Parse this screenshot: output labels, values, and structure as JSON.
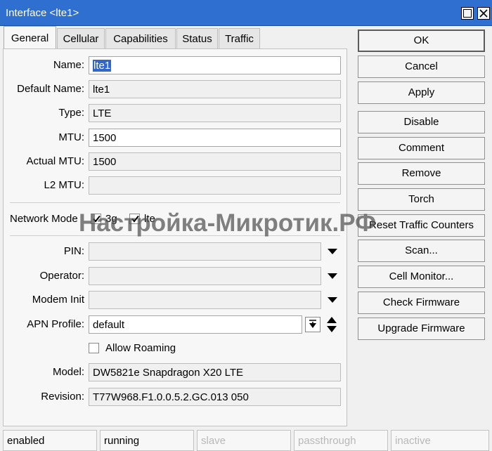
{
  "window": {
    "title": "Interface <lte1>"
  },
  "tabs": [
    {
      "label": "General"
    },
    {
      "label": "Cellular"
    },
    {
      "label": "Capabilities"
    },
    {
      "label": "Status"
    },
    {
      "label": "Traffic"
    }
  ],
  "form": {
    "name": {
      "label": "Name:",
      "value": "lte1"
    },
    "default_name": {
      "label": "Default Name:",
      "value": "lte1"
    },
    "type": {
      "label": "Type:",
      "value": "LTE"
    },
    "mtu": {
      "label": "MTU:",
      "value": "1500"
    },
    "actual_mtu": {
      "label": "Actual MTU:",
      "value": "1500"
    },
    "l2_mtu": {
      "label": "L2 MTU:",
      "value": ""
    },
    "network_mode": {
      "label": "Network Mode",
      "options": [
        {
          "label": "3g",
          "checked": true
        },
        {
          "label": "lte",
          "checked": true
        }
      ]
    },
    "pin": {
      "label": "PIN:",
      "value": ""
    },
    "operator": {
      "label": "Operator:",
      "value": ""
    },
    "modem_init": {
      "label": "Modem Init",
      "value": ""
    },
    "apn_profile": {
      "label": "APN Profile:",
      "value": "default"
    },
    "allow_roaming": {
      "label": "Allow Roaming",
      "checked": false
    },
    "model": {
      "label": "Model:",
      "value": "DW5821e Snapdragon X20 LTE"
    },
    "revision": {
      "label": "Revision:",
      "value": "T77W968.F1.0.0.5.2.GC.013 050"
    }
  },
  "buttons": {
    "ok": "OK",
    "cancel": "Cancel",
    "apply": "Apply",
    "disable": "Disable",
    "comment": "Comment",
    "remove": "Remove",
    "torch": "Torch",
    "reset_counters": "Reset Traffic Counters",
    "scan": "Scan...",
    "cell_monitor": "Cell Monitor...",
    "check_firmware": "Check Firmware",
    "upgrade_firmware": "Upgrade Firmware"
  },
  "statusbar": {
    "enabled": "enabled",
    "running": "running",
    "slave": "slave",
    "passthrough": "passthrough",
    "inactive": "inactive"
  },
  "watermark": "Настройка-Микротик.РФ",
  "colors": {
    "titlebar": "#2f6fd0",
    "selection": "#3067c9",
    "background": "#f0f0f0"
  },
  "icons": {
    "restore": "restore-icon",
    "close": "close-icon",
    "dropdown": "triangle-down-icon",
    "spinner": "up-down-arrows-icon"
  }
}
